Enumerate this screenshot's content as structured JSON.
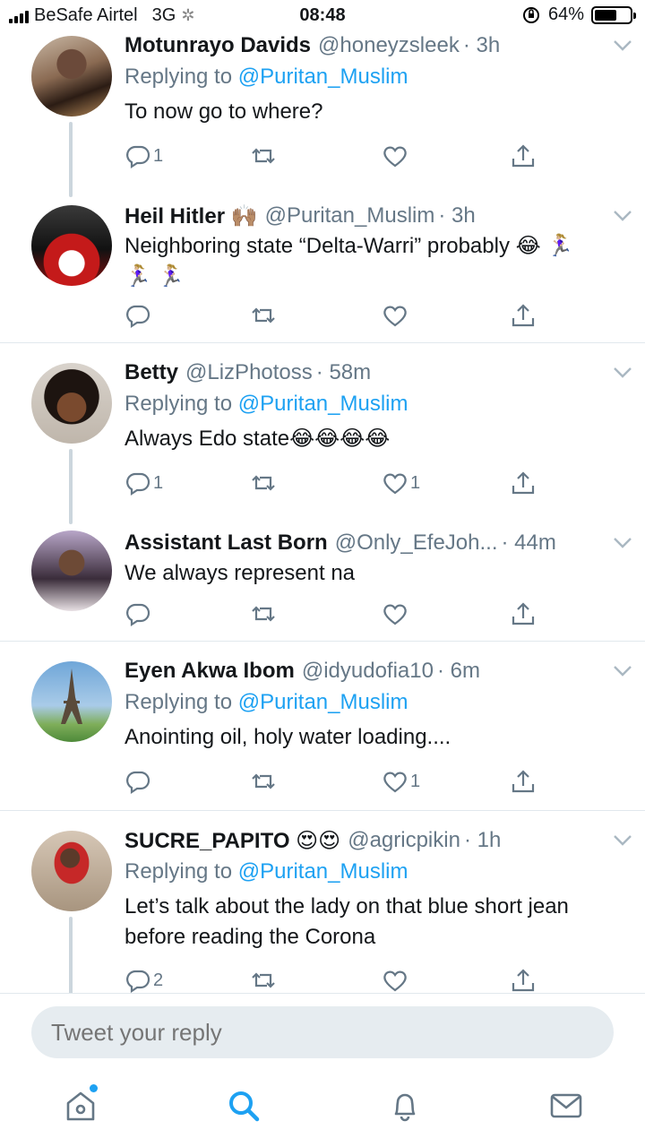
{
  "status_bar": {
    "carrier": "BeSafe Airtel",
    "network": "3G",
    "time": "08:48",
    "battery": "64%",
    "battery_level": 0.64
  },
  "tweets": [
    {
      "name": "Motunrayo Davids",
      "handle": "@honeyzsleek",
      "time": "· 3h",
      "reply_prefix": "Replying to",
      "reply_to": "@Puritan_Muslim",
      "text": "To now go to where?",
      "replies": "1",
      "likes": ""
    },
    {
      "name": "Heil Hitler 🙌🏽",
      "handle": "@Puritan_Muslim",
      "time": "· 3h",
      "text": "Neighboring state “Delta-Warri” probably 😂 🏃🏼‍♀️ 🏃🏼‍♀️ 🏃🏼‍♀️",
      "replies": "",
      "likes": ""
    },
    {
      "name": "Betty",
      "handle": "@LizPhotoss",
      "time": "· 58m",
      "reply_prefix": "Replying to",
      "reply_to": "@Puritan_Muslim",
      "text": "Always Edo state😂😂😂😂",
      "replies": "1",
      "likes": "1"
    },
    {
      "name": "Assistant Last Born",
      "handle": "@Only_EfeJoh...",
      "time": "· 44m",
      "text": "We always represent na",
      "replies": "",
      "likes": ""
    },
    {
      "name": "Eyen Akwa Ibom",
      "handle": "@idyudofia10",
      "time": "· 6m",
      "reply_prefix": "Replying to",
      "reply_to": "@Puritan_Muslim",
      "text": "Anointing oil, holy water loading....",
      "replies": "",
      "likes": "1"
    },
    {
      "name": "SUCRE_PAPITO 😍😍",
      "handle": "@agricpikin",
      "time": "· 1h",
      "reply_prefix": "Replying to",
      "reply_to": "@Puritan_Muslim",
      "text": "Let’s talk about the lady on that blue short jean before reading the Corona",
      "replies": "2",
      "likes": ""
    }
  ],
  "reply_bar": {
    "placeholder": "Tweet your reply"
  },
  "tab_bar": {
    "items": [
      "home-icon",
      "search-icon",
      "notifications-icon",
      "messages-icon"
    ],
    "active": "search-icon"
  },
  "colors": {
    "accent": "#1da1f2",
    "text": "#14171a",
    "secondary": "#657786",
    "divider": "#e1e8ed"
  }
}
